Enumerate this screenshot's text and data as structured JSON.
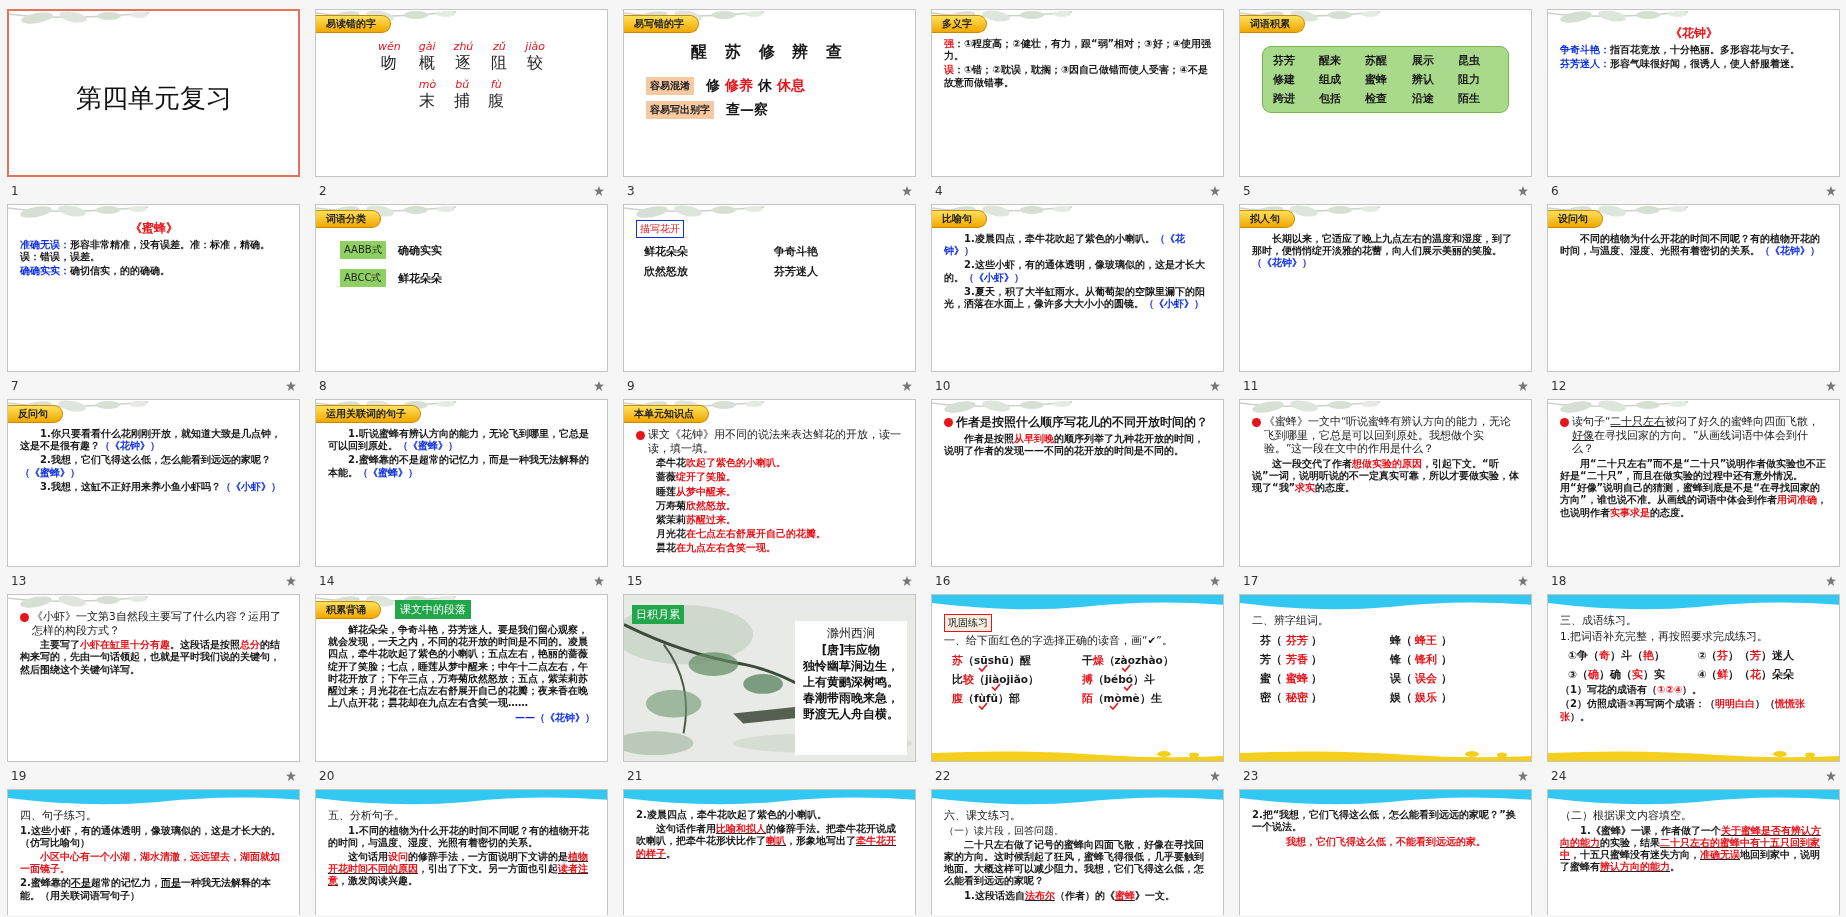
{
  "slides": [
    {
      "number": "1",
      "selected": true,
      "animated": false,
      "kind": "ink",
      "blocks": [
        {
          "kind": "title",
          "text": "第四单元复习"
        }
      ]
    },
    {
      "number": "2",
      "selected": false,
      "animated": true,
      "kind": "ink",
      "blocks": [
        {
          "kind": "tag",
          "text": "易读错的字"
        },
        {
          "kind": "pinyin",
          "items": [
            {
              "pinyin": "wěn",
              "char": "吻"
            },
            {
              "pinyin": "gài",
              "char": "概"
            },
            {
              "pinyin": "zhú",
              "char": "逐"
            },
            {
              "pinyin": "zǔ",
              "char": "阻"
            },
            {
              "pinyin": "jiào",
              "char": "较"
            }
          ]
        },
        {
          "kind": "pinyin",
          "items": [
            {
              "pinyin": "mò",
              "char": "末"
            },
            {
              "pinyin": "bǔ",
              "char": "捕"
            },
            {
              "pinyin": "fù",
              "char": "腹"
            }
          ]
        }
      ]
    },
    {
      "number": "3",
      "selected": false,
      "animated": true,
      "kind": "ink",
      "blocks": [
        {
          "kind": "tag",
          "text": "易写错的字"
        },
        {
          "kind": "bigline",
          "text": "醒 苏 修 辨 查"
        },
        {
          "kind": "confusable",
          "label": "容易混淆",
          "parts": [
            {
              "text": "修 "
            },
            {
              "text": "修养",
              "color": "#e8141b"
            },
            {
              "text": " 休 "
            },
            {
              "text": "休息",
              "color": "#e8141b"
            }
          ]
        },
        {
          "kind": "confusable",
          "label": "容易写出别字",
          "parts": [
            {
              "text": "查—察"
            }
          ]
        }
      ]
    },
    {
      "number": "4",
      "selected": false,
      "animated": true,
      "kind": "ink",
      "blocks": [
        {
          "kind": "tag",
          "text": "多义字"
        },
        {
          "kind": "answer",
          "parts": [
            {
              "text": "强",
              "color": "#e8141b"
            },
            {
              "text": "：①程度高；②健壮，有力，跟“弱”相对；③好；④使用强力。"
            }
          ]
        },
        {
          "kind": "answer",
          "parts": [
            {
              "text": "误",
              "color": "#e8141b"
            },
            {
              "text": "：①错；②耽误，耽搁；③因自己做错而使人受害；④不是故意而做错事。"
            }
          ]
        }
      ]
    },
    {
      "number": "5",
      "selected": false,
      "animated": true,
      "kind": "ink",
      "blocks": [
        {
          "kind": "tag",
          "text": "词语积累"
        },
        {
          "kind": "wordbox",
          "cells": [
            [
              {
                "text": "芬芳"
              }
            ],
            [
              {
                "text": "醒来"
              }
            ],
            [
              {
                "text": "苏醒"
              }
            ],
            [
              {
                "text": "展示"
              }
            ],
            [
              {
                "text": "昆虫"
              }
            ],
            [
              {
                "text": "修建"
              }
            ],
            [
              {
                "text": "组成"
              }
            ],
            [
              {
                "text": "蜜蜂"
              }
            ],
            [
              {
                "text": "辨认"
              }
            ],
            [
              {
                "text": "阻力"
              }
            ],
            [
              {
                "text": "跨进"
              }
            ],
            [
              {
                "text": "包括"
              }
            ],
            [
              {
                "text": "检查"
              }
            ],
            [
              {
                "text": "沿途"
              }
            ],
            [
              {
                "text": "陌生"
              }
            ]
          ]
        }
      ]
    },
    {
      "number": "6",
      "selected": false,
      "animated": true,
      "kind": "ink",
      "blocks": [
        {
          "kind": "caption",
          "parts": [
            {
              "text": "《花钟》",
              "color": "#e8141b"
            }
          ]
        },
        {
          "kind": "answer",
          "parts": [
            {
              "text": "争奇斗艳：",
              "color": "#1030e0"
            },
            {
              "text": "指百花竞放，十分艳丽。多形容花与女子。"
            }
          ]
        },
        {
          "kind": "answer",
          "parts": [
            {
              "text": "芬芳迷人：",
              "color": "#1030e0"
            },
            {
              "text": "形容气味很好闻，很诱人，使人舒服着迷。"
            }
          ]
        }
      ]
    },
    {
      "number": "7",
      "selected": false,
      "animated": true,
      "kind": "ink",
      "blocks": [
        {
          "kind": "caption",
          "parts": [
            {
              "text": "《蜜蜂》",
              "color": "#e8141b"
            }
          ]
        },
        {
          "kind": "answer",
          "parts": [
            {
              "text": "准确无误：",
              "color": "#1030e0"
            },
            {
              "text": "形容非常精准，没有误差。准：标准，精确。误：错误，误差。"
            }
          ]
        },
        {
          "kind": "answer",
          "parts": [
            {
              "text": "确确实实：",
              "color": "#1030e0"
            },
            {
              "text": "确切信实，的的确确。"
            }
          ]
        }
      ]
    },
    {
      "number": "8",
      "selected": false,
      "animated": true,
      "kind": "ink",
      "blocks": [
        {
          "kind": "tag",
          "text": "词语分类"
        },
        {
          "kind": "pattern",
          "label": "AABB式",
          "parts": [
            {
              "text": "确确实实"
            }
          ]
        },
        {
          "kind": "pattern",
          "label": "ABCC式",
          "parts": [
            {
              "text": "鲜花朵朵"
            }
          ]
        }
      ]
    },
    {
      "number": "9",
      "selected": false,
      "animated": true,
      "kind": "ink",
      "blocks": [
        {
          "kind": "boxlabel",
          "text": "描写花开"
        },
        {
          "kind": "words",
          "cells": [
            [
              {
                "text": "鲜花朵朵"
              }
            ],
            [
              {
                "text": "争奇斗艳"
              }
            ],
            [
              {
                "text": "欣然怒放"
              }
            ],
            [
              {
                "text": "芬芳迷人"
              }
            ]
          ]
        }
      ]
    },
    {
      "number": "10",
      "selected": false,
      "animated": true,
      "kind": "ink",
      "blocks": [
        {
          "kind": "tag",
          "text": "比喻句"
        },
        {
          "kind": "answer",
          "indent": true,
          "parts": [
            {
              "text": "1.凌晨四点，牵牛花吹起了紫色的小喇叭。"
            },
            {
              "text": "（《花钟》）",
              "color": "#1030e0"
            }
          ]
        },
        {
          "kind": "answer",
          "indent": true,
          "parts": [
            {
              "text": "2.这些小虾，有的通体透明，像玻璃似的，这是才长大的。"
            },
            {
              "text": "（《小虾》）",
              "color": "#1030e0"
            }
          ]
        },
        {
          "kind": "answer",
          "indent": true,
          "parts": [
            {
              "text": "3.夏天，积了大半缸雨水。从葡萄架的空隙里漏下的阳光，洒落在水面上，像许多大大小小的圆镜。"
            },
            {
              "text": "（《小虾》）",
              "color": "#1030e0"
            }
          ]
        }
      ]
    },
    {
      "number": "11",
      "selected": false,
      "animated": true,
      "kind": "ink",
      "blocks": [
        {
          "kind": "tag",
          "text": "拟人句"
        },
        {
          "kind": "answer",
          "indent": true,
          "parts": [
            {
              "text": "长期以来，它适应了晚上九点左右的温度和湿度，到了那时，便悄悄绽开淡雅的花蕾，向人们展示美丽的笑脸。"
            },
            {
              "text": "（《花钟》）",
              "color": "#1030e0"
            }
          ]
        }
      ]
    },
    {
      "number": "12",
      "selected": false,
      "animated": true,
      "kind": "ink",
      "blocks": [
        {
          "kind": "tag",
          "text": "设问句"
        },
        {
          "kind": "answer",
          "indent": true,
          "parts": [
            {
              "text": "不同的植物为什么开花的时间不同呢？有的植物开花的时间，与温度、湿度、光照有着密切的关系。"
            },
            {
              "text": "（《花钟》）",
              "color": "#1030e0"
            }
          ]
        }
      ]
    },
    {
      "number": "13",
      "selected": false,
      "animated": true,
      "kind": "ink",
      "blocks": [
        {
          "kind": "tag",
          "text": "反问句"
        },
        {
          "kind": "answer",
          "indent": true,
          "parts": [
            {
              "text": "1.你只要看看什么花刚刚开放，就知道大致是几点钟，这是不是很有趣？"
            },
            {
              "text": "（《花钟》）",
              "color": "#1030e0"
            }
          ]
        },
        {
          "kind": "answer",
          "indent": true,
          "parts": [
            {
              "text": "2.我想，它们飞得这么低，怎么能看到远远的家呢？"
            },
            {
              "text": "（《蜜蜂》）",
              "color": "#1030e0"
            }
          ]
        },
        {
          "kind": "answer",
          "indent": true,
          "parts": [
            {
              "text": "3.我想，这缸不正好用来养小鱼小虾吗？"
            },
            {
              "text": "（《小虾》）",
              "color": "#1030e0"
            }
          ]
        }
      ]
    },
    {
      "number": "14",
      "selected": false,
      "animated": true,
      "kind": "ink",
      "blocks": [
        {
          "kind": "tag",
          "text": "运用关联词的句子"
        },
        {
          "kind": "answer",
          "indent": true,
          "parts": [
            {
              "text": "1.听说蜜蜂有辨认方向的能力，无论飞到哪里，它总是可以回到原处。"
            },
            {
              "text": "（《蜜蜂》）",
              "color": "#1030e0"
            }
          ]
        },
        {
          "kind": "answer",
          "indent": true,
          "parts": [
            {
              "text": "2.蜜蜂靠的不是超常的记忆力，而是一种我无法解释的本能。"
            },
            {
              "text": "（《蜜蜂》）",
              "color": "#1030e0"
            }
          ]
        }
      ]
    },
    {
      "number": "15",
      "selected": false,
      "animated": true,
      "kind": "ink",
      "blocks": [
        {
          "kind": "tag",
          "text": "本单元知识点"
        },
        {
          "kind": "question",
          "bullet": true,
          "parts": [
            {
              "text": "课文《花钟》用不同的说法来表达鲜花的开放，读一读，填一填。"
            }
          ]
        },
        {
          "kind": "answer",
          "indent": true,
          "parts": [
            {
              "text": "牵牛花"
            },
            {
              "text": "吹起了紫色的小喇叭。",
              "color": "#e8141b"
            }
          ]
        },
        {
          "kind": "answer",
          "indent": true,
          "parts": [
            {
              "text": "蔷薇"
            },
            {
              "text": "绽开了笑脸。",
              "color": "#e8141b"
            }
          ]
        },
        {
          "kind": "answer",
          "indent": true,
          "parts": [
            {
              "text": "睡莲"
            },
            {
              "text": "从梦中醒来。",
              "color": "#e8141b"
            }
          ]
        },
        {
          "kind": "answer",
          "indent": true,
          "parts": [
            {
              "text": "万寿菊"
            },
            {
              "text": "欣然怒放。",
              "color": "#e8141b"
            }
          ]
        },
        {
          "kind": "answer",
          "indent": true,
          "parts": [
            {
              "text": "紫茉莉"
            },
            {
              "text": "苏醒过来。",
              "color": "#e8141b"
            }
          ]
        },
        {
          "kind": "answer",
          "indent": true,
          "parts": [
            {
              "text": "月光花"
            },
            {
              "text": "在七点左右舒展开自己的花瓣。",
              "color": "#e8141b"
            }
          ]
        },
        {
          "kind": "answer",
          "indent": true,
          "parts": [
            {
              "text": "昙花"
            },
            {
              "text": "在九点左右含笑一现。",
              "color": "#e8141b"
            }
          ]
        }
      ]
    },
    {
      "number": "16",
      "selected": false,
      "animated": true,
      "kind": "ink",
      "blocks": [
        {
          "kind": "heading",
          "bullet": true,
          "parts": [
            {
              "text": "作者是按照什么顺序写花儿的不同开放时间的？"
            }
          ]
        },
        {
          "kind": "answer",
          "indent": true,
          "parts": [
            {
              "text": "作者是按照"
            },
            {
              "text": "从早到晚",
              "color": "#e8141b"
            },
            {
              "text": "的顺序列举了九种花开放的时间，说明了作者的发现——不同的花开放的时间是不同的。"
            }
          ]
        }
      ]
    },
    {
      "number": "17",
      "selected": false,
      "animated": true,
      "kind": "ink",
      "blocks": [
        {
          "kind": "question",
          "bullet": true,
          "parts": [
            {
              "text": "《蜜蜂》一文中“听说蜜蜂有辨认方向的能力，无论飞到哪里，它总是可以回到原处。我想做个实验。”这一段在文中的作用是什么？"
            }
          ]
        },
        {
          "kind": "answer",
          "indent": true,
          "parts": [
            {
              "text": "这一段交代了作者"
            },
            {
              "text": "想做实验的原因",
              "color": "#e8141b"
            },
            {
              "text": "，引起下文。“听说”一词，说明听说的不一定真实可靠，所以才要做实验，体现了“我”"
            },
            {
              "text": "求实",
              "color": "#e8141b"
            },
            {
              "text": "的态度。"
            }
          ]
        }
      ]
    },
    {
      "number": "18",
      "selected": false,
      "animated": true,
      "kind": "ink",
      "blocks": [
        {
          "kind": "question",
          "bullet": true,
          "parts": [
            {
              "text": "读句子“",
              "kind": "text"
            },
            {
              "text": "二十只左右",
              "kind": "blank"
            },
            {
              "text": "被闷了好久的蜜蜂向四面飞散，",
              "kind": "text"
            },
            {
              "text": "好像",
              "kind": "blank"
            },
            {
              "text": "在寻找回家的方向。”从画线词语中体会到什么？",
              "kind": "text"
            }
          ]
        },
        {
          "kind": "answer",
          "indent": true,
          "parts": [
            {
              "text": "用“二十只左右”而不是“二十只”说明作者做实验也不正好是“二十只”，而且在做实验的过程中还有意外情况。用“好像”说明自己的猜测，蜜蜂到底是不是“在寻找回家的方向”，谁也说不准。从画线的词语中体会到作者"
            },
            {
              "text": "用词准确",
              "color": "#e8141b"
            },
            {
              "text": "，也说明作者"
            },
            {
              "text": "实事求是",
              "color": "#e8141b"
            },
            {
              "text": "的态度。"
            }
          ]
        }
      ]
    },
    {
      "number": "19",
      "selected": false,
      "animated": true,
      "kind": "ink",
      "blocks": [
        {
          "kind": "question",
          "bullet": true,
          "parts": [
            {
              "text": "《小虾》一文第3自然段主要写了什么内容？运用了怎样的构段方式？"
            }
          ]
        },
        {
          "kind": "answer",
          "indent": true,
          "parts": [
            {
              "text": "主要写了"
            },
            {
              "text": "小虾在缸里十分有趣",
              "color": "#e8141b"
            },
            {
              "text": "。这段话是按照"
            },
            {
              "text": "总分",
              "color": "#e8141b"
            },
            {
              "text": "的结构来写的，先由一句话领起，也就是平时我们说的关键句，然后围绕这个关键句详写。"
            }
          ]
        }
      ]
    },
    {
      "number": "20",
      "selected": false,
      "animated": false,
      "kind": "ink",
      "blocks": [
        {
          "kind": "tag",
          "text": "积累背诵",
          "extra": "课文中的段落"
        },
        {
          "kind": "answer",
          "indent": true,
          "parts": [
            {
              "text": "鲜花朵朵，争奇斗艳，芬芳迷人。要是我们留心观察，就会发现，一天之内，不同的花开放的时间是不同的。凌晨四点，牵牛花吹起了紫色的小喇叭；五点左右，艳丽的蔷薇绽开了笑脸；七点，睡莲从梦中醒来；中午十二点左右，午时花开放了；下午三点，万寿菊欣然怒放；五点，紫茉莉苏醒过来；月光花在七点左右舒展开自己的花瓣；夜来香在晚上八点开花；昙花却在九点左右含笑一现……"
            }
          ]
        },
        {
          "kind": "source",
          "parts": [
            {
              "text": "——（《花钟》）",
              "color": "#1030e0"
            }
          ]
        }
      ]
    },
    {
      "number": "21",
      "selected": false,
      "animated": false,
      "kind": "picture",
      "blocks": [
        {
          "kind": "poem",
          "tag": "日积月累",
          "title": "滁州西涧",
          "author": "[唐]韦应物",
          "lines": [
            "独怜幽草涧边生，",
            "上有黄鹂深树鸣。",
            "春潮带雨晚来急，",
            "野渡无人舟自横。"
          ]
        }
      ]
    },
    {
      "number": "22",
      "selected": false,
      "animated": true,
      "kind": "wave",
      "blocks": [
        {
          "kind": "exercise",
          "text": "巩固练习"
        },
        {
          "kind": "question",
          "parts": [
            {
              "text": "一、给下面红色的字选择正确的读音，画“✔”。"
            }
          ]
        },
        {
          "kind": "words",
          "cells": [
            [
              {
                "text": "苏",
                "color": "#e8141b"
              },
              {
                "text": "（"
              },
              {
                "text": "sū",
                "checked": true
              },
              {
                "text": " shū",
                "checked": false
              },
              {
                "text": "）醒"
              }
            ],
            [
              {
                "text": "干"
              },
              {
                "text": "燥",
                "color": "#e8141b"
              },
              {
                "text": "（"
              },
              {
                "text": "zào",
                "checked": true
              },
              {
                "text": " zhào",
                "checked": false
              },
              {
                "text": "）"
              }
            ],
            [
              {
                "text": "比"
              },
              {
                "text": "较",
                "color": "#e8141b"
              },
              {
                "text": "（"
              },
              {
                "text": "jiào",
                "checked": true
              },
              {
                "text": " jiǎo",
                "checked": false
              },
              {
                "text": "）"
              }
            ],
            [
              {
                "text": "搏",
                "color": "#e8141b"
              },
              {
                "text": "（"
              },
              {
                "text": "bé",
                "checked": false
              },
              {
                "text": " bó",
                "checked": true
              },
              {
                "text": "）斗"
              }
            ],
            [
              {
                "text": "腹",
                "color": "#e8141b"
              },
              {
                "text": "（"
              },
              {
                "text": "fù",
                "checked": true
              },
              {
                "text": " fǔ",
                "checked": false
              },
              {
                "text": "）部"
              }
            ],
            [
              {
                "text": "陌",
                "color": "#e8141b"
              },
              {
                "text": "（"
              },
              {
                "text": "mò",
                "checked": true
              },
              {
                "text": " mè",
                "checked": false
              },
              {
                "text": "）生"
              }
            ]
          ]
        }
      ]
    },
    {
      "number": "23",
      "selected": false,
      "animated": true,
      "kind": "wave",
      "blocks": [
        {
          "kind": "question",
          "parts": [
            {
              "text": "二、辨字组词。"
            }
          ]
        },
        {
          "kind": "words",
          "cells": [
            [
              {
                "text": "芬（ "
              },
              {
                "text": "芬芳",
                "color": "#e8141b"
              },
              {
                "text": " ）"
              }
            ],
            [
              {
                "text": "蜂（ "
              },
              {
                "text": "蜂王",
                "color": "#e8141b"
              },
              {
                "text": " ）"
              }
            ],
            [
              {
                "text": "芳（ "
              },
              {
                "text": "芳香",
                "color": "#e8141b"
              },
              {
                "text": " ）"
              }
            ],
            [
              {
                "text": "锋（ "
              },
              {
                "text": "锋利",
                "color": "#e8141b"
              },
              {
                "text": " ）"
              }
            ],
            [
              {
                "text": "蜜（ "
              },
              {
                "text": "蜜蜂",
                "color": "#e8141b"
              },
              {
                "text": " ）"
              }
            ],
            [
              {
                "text": "误（ "
              },
              {
                "text": "误会",
                "color": "#e8141b"
              },
              {
                "text": " ）"
              }
            ],
            [
              {
                "text": "密（ "
              },
              {
                "text": "秘密",
                "color": "#e8141b"
              },
              {
                "text": " ）"
              }
            ],
            [
              {
                "text": "娱（ "
              },
              {
                "text": "娱乐",
                "color": "#e8141b"
              },
              {
                "text": " ）"
              }
            ]
          ]
        }
      ]
    },
    {
      "number": "24",
      "selected": false,
      "animated": true,
      "kind": "wave",
      "blocks": [
        {
          "kind": "question",
          "parts": [
            {
              "text": "三、成语练习。"
            }
          ]
        },
        {
          "kind": "question",
          "parts": [
            {
              "text": "1.把词语补充完整，再按照要求完成练习。"
            }
          ]
        },
        {
          "kind": "words",
          "cells": [
            [
              {
                "text": "①争（"
              },
              {
                "text": "奇",
                "color": "#e8141b"
              },
              {
                "text": "）斗（"
              },
              {
                "text": "艳",
                "color": "#e8141b"
              },
              {
                "text": "）"
              }
            ],
            [
              {
                "text": "②（"
              },
              {
                "text": "芬",
                "color": "#e8141b"
              },
              {
                "text": "）（"
              },
              {
                "text": "芳",
                "color": "#e8141b"
              },
              {
                "text": "）迷人"
              }
            ],
            [
              {
                "text": "③（"
              },
              {
                "text": "确",
                "color": "#e8141b"
              },
              {
                "text": "）确（"
              },
              {
                "text": "实",
                "color": "#e8141b"
              },
              {
                "text": "）实"
              }
            ],
            [
              {
                "text": "④（"
              },
              {
                "text": "鲜",
                "color": "#e8141b"
              },
              {
                "text": "）（"
              },
              {
                "text": "花",
                "color": "#e8141b"
              },
              {
                "text": "）朵朵"
              }
            ]
          ]
        },
        {
          "kind": "answer",
          "parts": [
            {
              "text": "（1）写花的成语有（"
            },
            {
              "text": "①②④",
              "color": "#e8141b"
            },
            {
              "text": "）。"
            }
          ]
        },
        {
          "kind": "answer",
          "parts": [
            {
              "text": "（2）仿照成语③再写两个成语：（"
            },
            {
              "text": "明明白白",
              "color": "#e8141b"
            },
            {
              "text": "）（"
            },
            {
              "text": "慌慌张张",
              "color": "#e8141b"
            },
            {
              "text": "）。"
            }
          ]
        }
      ]
    },
    {
      "selected": false,
      "kind": "wave",
      "blocks": [
        {
          "kind": "question",
          "parts": [
            {
              "text": "四、句子练习。"
            }
          ]
        },
        {
          "kind": "answer",
          "parts": [
            {
              "text": "1.这些小虾，有的通体透明，像玻璃似的，这是才长大的。（仿写比喻句）"
            }
          ]
        },
        {
          "kind": "answer",
          "indent": true,
          "parts": [
            {
              "text": "小区中心有一个小湖，湖水清澈，远远望去，湖面就如一面镜子。",
              "color": "#e8141b"
            }
          ]
        },
        {
          "kind": "answer",
          "parts": [
            {
              "text": "2.蜜蜂靠的",
              "kind": "text"
            },
            {
              "text": "不是",
              "kind": "blank"
            },
            {
              "text": "超常的记忆力，",
              "kind": "text"
            },
            {
              "text": "而是",
              "kind": "blank"
            },
            {
              "text": "一种我无法解释的本能。（用关联词语写句子）",
              "kind": "text"
            }
          ]
        }
      ]
    },
    {
      "selected": false,
      "kind": "wave",
      "blocks": [
        {
          "kind": "question",
          "parts": [
            {
              "text": "五、分析句子。"
            }
          ]
        },
        {
          "kind": "answer",
          "indent": true,
          "parts": [
            {
              "text": "1.不同的植物为什么开花的时间不同呢？有的植物开花的时间，与温度、湿度、光照有着密切的关系。"
            }
          ]
        },
        {
          "kind": "answer",
          "indent": true,
          "parts": [
            {
              "text": "这句话用",
              "kind": "text"
            },
            {
              "text": "设问",
              "color": "#e8141b",
              "kind": "text"
            },
            {
              "text": "的修辞手法，一方面说明下文讲的是",
              "kind": "text"
            },
            {
              "text": "植物开花时间不同的原因",
              "color": "#e8141b",
              "kind": "blank"
            },
            {
              "text": "，引出了下文。另一方面也引起",
              "kind": "text"
            },
            {
              "text": "读者注意",
              "color": "#e8141b",
              "kind": "blank"
            },
            {
              "text": "，激发阅读兴趣。",
              "kind": "text"
            }
          ]
        }
      ]
    },
    {
      "selected": false,
      "kind": "wave",
      "blocks": [
        {
          "kind": "answer",
          "parts": [
            {
              "text": "2.凌晨四点，牵牛花吹起了紫色的小喇叭。"
            }
          ]
        },
        {
          "kind": "answer",
          "indent": true,
          "parts": [
            {
              "text": "这句话作者用",
              "kind": "text"
            },
            {
              "text": "比喻和拟人",
              "color": "#e8141b",
              "kind": "blank"
            },
            {
              "text": "的修辞手法。把牵牛花开说成吹喇叭，把牵牛花形状比作了",
              "kind": "text"
            },
            {
              "text": "喇叭",
              "color": "#e8141b",
              "kind": "blank"
            },
            {
              "text": "，形象地写出了",
              "kind": "text"
            },
            {
              "text": "牵牛花开的样子",
              "color": "#e8141b",
              "kind": "blank"
            },
            {
              "text": "。",
              "kind": "text"
            }
          ]
        }
      ]
    },
    {
      "selected": false,
      "kind": "wave",
      "blocks": [
        {
          "kind": "question",
          "parts": [
            {
              "text": "六、课文练习。"
            }
          ]
        },
        {
          "kind": "note",
          "parts": [
            {
              "text": "（一）读片段，回答问题。"
            }
          ]
        },
        {
          "kind": "answer",
          "indent": true,
          "parts": [
            {
              "text": "二十只左右做了记号的蜜蜂向四面飞散，好像在寻找回家的方向。这时候刮起了狂风，蜜蜂飞得很低，几乎要触到地面。大概这样可以减少阻力。我想，它们飞得这么低，怎么能看到远远的家呢？"
            }
          ]
        },
        {
          "kind": "answer",
          "indent": true,
          "parts": [
            {
              "text": "1.这段话选自",
              "kind": "text"
            },
            {
              "text": "法布尔",
              "color": "#e8141b",
              "kind": "blank"
            },
            {
              "text": "（作者）的《",
              "kind": "text"
            },
            {
              "text": "蜜蜂",
              "color": "#e8141b",
              "kind": "blank"
            },
            {
              "text": "》一文。",
              "kind": "text"
            }
          ]
        }
      ]
    },
    {
      "selected": false,
      "kind": "wave",
      "blocks": [
        {
          "kind": "answer",
          "parts": [
            {
              "text": "2.把“我想，它们飞得这么低，怎么能看到远远的家呢？”换一个说法。"
            }
          ]
        },
        {
          "kind": "response",
          "parts": [
            {
              "text": "我想，它们飞得这么低，不能看到远远的家。",
              "color": "#e8141b"
            }
          ]
        }
      ]
    },
    {
      "selected": false,
      "kind": "wave",
      "blocks": [
        {
          "kind": "question",
          "parts": [
            {
              "text": "（二）根据课文内容填空。"
            }
          ]
        },
        {
          "kind": "answer",
          "indent": true,
          "parts": [
            {
              "text": "1.《蜜蜂》一课，作者做了一个",
              "kind": "text"
            },
            {
              "text": "关于蜜蜂是否有辨认方向的能力",
              "color": "#e8141b",
              "kind": "blank"
            },
            {
              "text": "的实验，结果",
              "kind": "text"
            },
            {
              "text": "二十只左右的蜜蜂中有十五只回到家中",
              "color": "#e8141b",
              "kind": "blank"
            },
            {
              "text": "，十五只蜜蜂没有迷失方向，",
              "kind": "text"
            },
            {
              "text": "准确无误",
              "color": "#e8141b",
              "kind": "blank"
            },
            {
              "text": "地回到家中，说明了蜜蜂有",
              "kind": "text"
            },
            {
              "text": "辨认方向的能力",
              "color": "#e8141b",
              "kind": "blank"
            },
            {
              "text": "。",
              "kind": "text"
            }
          ]
        }
      ]
    }
  ]
}
